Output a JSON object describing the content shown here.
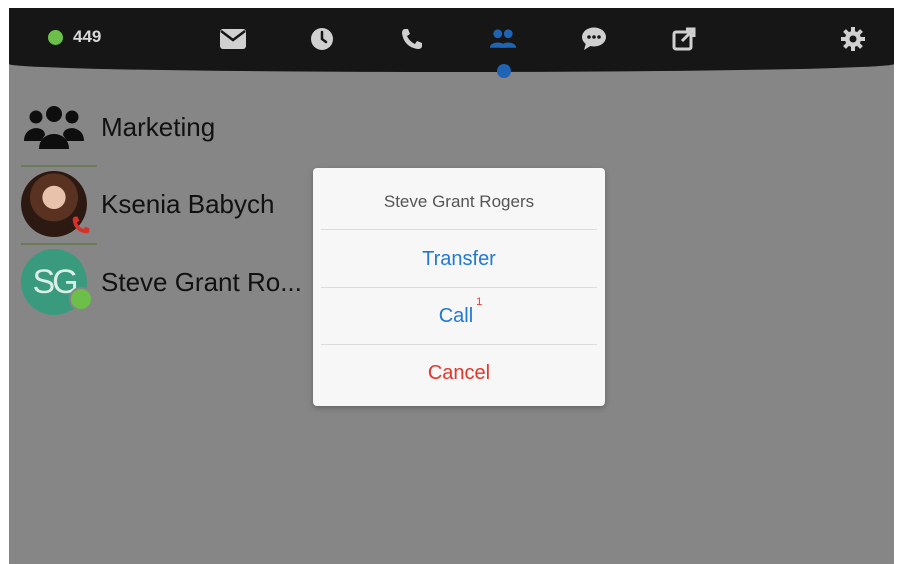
{
  "topbar": {
    "status_count": "449",
    "status_color": "#6cc04a",
    "icons": [
      "mail-icon",
      "clock-icon",
      "phone-icon",
      "contacts-icon",
      "chat-icon",
      "external-link-icon",
      "gear-icon"
    ],
    "active_tab": "contacts-icon",
    "active_color": "#1f63b5"
  },
  "contacts": [
    {
      "name": "Marketing",
      "avatar": "group-icon"
    },
    {
      "name": "Ksenia Babych",
      "avatar": "photo",
      "status": "on-call"
    },
    {
      "name": "Steve Grant Ro...",
      "avatar_initials": "SG",
      "status": "online"
    }
  ],
  "dialog": {
    "title": "Steve Grant Rogers",
    "transfer_label": "Transfer",
    "call_label": "Call",
    "call_badge": "1",
    "cancel_label": "Cancel",
    "action_color": "#2279d2",
    "cancel_color": "#e2372a"
  }
}
